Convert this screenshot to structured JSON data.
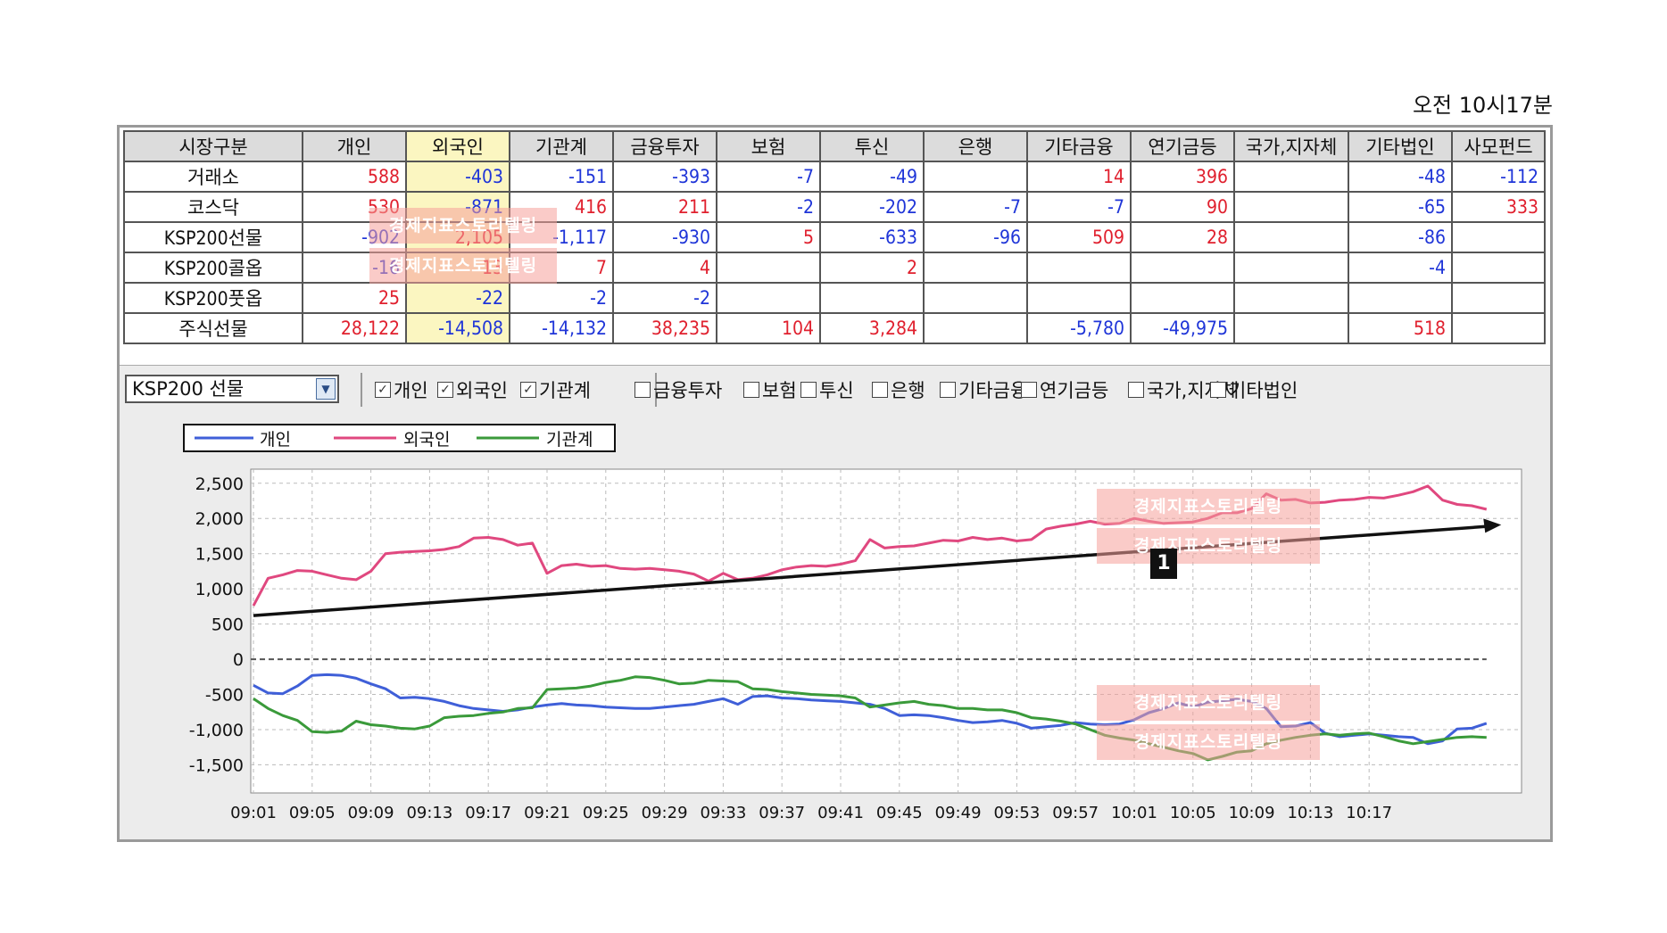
{
  "timestamp": "오전 10시17분",
  "table": {
    "headers": [
      "시장구분",
      "개인",
      "외국인",
      "기관계",
      "금융투자",
      "보험",
      "투신",
      "은행",
      "기타금융",
      "연기금등",
      "국가,지자체",
      "기타법인",
      "사모펀드"
    ],
    "rows": [
      {
        "label": "거래소",
        "values": [
          "588",
          "-403",
          "-151",
          "-393",
          "-7",
          "-49",
          "",
          "14",
          "396",
          "",
          "-48",
          "-112"
        ]
      },
      {
        "label": "코스닥",
        "values": [
          "530",
          "-871",
          "416",
          "211",
          "-2",
          "-202",
          "-7",
          "-7",
          "90",
          "",
          "-65",
          "333"
        ]
      },
      {
        "label": "KSP200선물",
        "values": [
          "-902",
          "2,105",
          "-1,117",
          "-930",
          "5",
          "-633",
          "-96",
          "509",
          "28",
          "",
          "-86",
          ""
        ]
      },
      {
        "label": "KSP200콜옵",
        "values": [
          "-16",
          "13",
          "7",
          "4",
          "",
          "2",
          "",
          "",
          "",
          "",
          "-4",
          ""
        ]
      },
      {
        "label": "KSP200풋옵",
        "values": [
          "25",
          "-22",
          "-2",
          "-2",
          "",
          "",
          "",
          "",
          "",
          "",
          "",
          ""
        ]
      },
      {
        "label": "주식선물",
        "values": [
          "28,122",
          "-14,508",
          "-14,132",
          "38,235",
          "104",
          "3,284",
          "",
          "-5,780",
          "-49,975",
          "",
          "518",
          ""
        ]
      }
    ]
  },
  "controls": {
    "select_value": "KSP200 선물",
    "checkboxes": [
      {
        "label": "개인",
        "checked": true
      },
      {
        "label": "외국인",
        "checked": true
      },
      {
        "label": "기관계",
        "checked": true
      },
      {
        "label": "금융투자",
        "checked": false
      },
      {
        "label": "보험",
        "checked": false
      },
      {
        "label": "투신",
        "checked": false
      },
      {
        "label": "은행",
        "checked": false
      },
      {
        "label": "기타금융",
        "checked": false
      },
      {
        "label": "연기금등",
        "checked": false
      },
      {
        "label": "국가,지자체",
        "checked": false
      },
      {
        "label": "기타법인",
        "checked": false
      }
    ]
  },
  "watermark_text": "경제지표스토리텔링",
  "annotation_badge": "1",
  "colors": {
    "individual": "#3f5fd8",
    "foreign": "#e0487f",
    "institution": "#3a9a3a",
    "positive": "#e0202e",
    "negative": "#1f35d8",
    "highlight": "#fbf6c1"
  },
  "chart_data": {
    "type": "line",
    "legend": [
      "개인",
      "외국인",
      "기관계"
    ],
    "legend_placement": "top-left",
    "x_tick_labels": [
      "09:01",
      "09:05",
      "09:09",
      "09:13",
      "09:17",
      "09:21",
      "09:25",
      "09:29",
      "09:33",
      "09:37",
      "09:41",
      "09:45",
      "09:49",
      "09:53",
      "09:57",
      "10:01",
      "10:05",
      "10:09",
      "10:13",
      "10:17"
    ],
    "ylim": [
      -1900,
      2700
    ],
    "y_ticks": [
      2500,
      2000,
      1500,
      1000,
      500,
      0,
      -500,
      -1000,
      -1500
    ],
    "y_tick_labels": [
      "2,500",
      "2,000",
      "1,500",
      "1,000",
      "500",
      "0",
      "-500",
      "-1,000",
      "-1,500"
    ],
    "grid": true,
    "zero_line": true,
    "x_minutes_range": [
      0,
      78
    ],
    "series": [
      {
        "name": "개인",
        "color": "#3f5fd8",
        "points": [
          [
            0,
            -370
          ],
          [
            1,
            -480
          ],
          [
            2,
            -490
          ],
          [
            3,
            -380
          ],
          [
            4,
            -230
          ],
          [
            5,
            -220
          ],
          [
            6,
            -230
          ],
          [
            7,
            -270
          ],
          [
            8,
            -350
          ],
          [
            9,
            -420
          ],
          [
            10,
            -550
          ],
          [
            11,
            -540
          ],
          [
            12,
            -560
          ],
          [
            13,
            -600
          ],
          [
            14,
            -660
          ],
          [
            15,
            -700
          ],
          [
            16,
            -720
          ],
          [
            17,
            -740
          ],
          [
            18,
            -720
          ],
          [
            19,
            -680
          ],
          [
            20,
            -650
          ],
          [
            21,
            -630
          ],
          [
            22,
            -650
          ],
          [
            23,
            -660
          ],
          [
            24,
            -680
          ],
          [
            25,
            -690
          ],
          [
            26,
            -700
          ],
          [
            27,
            -700
          ],
          [
            28,
            -680
          ],
          [
            29,
            -660
          ],
          [
            30,
            -640
          ],
          [
            31,
            -600
          ],
          [
            32,
            -560
          ],
          [
            33,
            -640
          ],
          [
            34,
            -530
          ],
          [
            35,
            -520
          ],
          [
            36,
            -550
          ],
          [
            37,
            -560
          ],
          [
            38,
            -580
          ],
          [
            39,
            -590
          ],
          [
            40,
            -600
          ],
          [
            41,
            -620
          ],
          [
            42,
            -640
          ],
          [
            43,
            -700
          ],
          [
            44,
            -800
          ],
          [
            45,
            -790
          ],
          [
            46,
            -800
          ],
          [
            47,
            -830
          ],
          [
            48,
            -870
          ],
          [
            49,
            -900
          ],
          [
            50,
            -890
          ],
          [
            51,
            -870
          ],
          [
            52,
            -910
          ],
          [
            53,
            -980
          ],
          [
            54,
            -960
          ],
          [
            55,
            -940
          ],
          [
            56,
            -900
          ],
          [
            57,
            -920
          ],
          [
            58,
            -930
          ],
          [
            59,
            -920
          ],
          [
            60,
            -860
          ],
          [
            61,
            -760
          ],
          [
            62,
            -700
          ],
          [
            63,
            -620
          ],
          [
            64,
            -680
          ],
          [
            65,
            -610
          ],
          [
            66,
            -590
          ],
          [
            67,
            -570
          ],
          [
            68,
            -600
          ],
          [
            69,
            -700
          ],
          [
            70,
            -960
          ],
          [
            71,
            -950
          ],
          [
            72,
            -900
          ],
          [
            73,
            -1050
          ],
          [
            74,
            -1100
          ],
          [
            75,
            -1080
          ],
          [
            76,
            -1060
          ],
          [
            77,
            -1080
          ],
          [
            78,
            -1100
          ],
          [
            79,
            -1110
          ],
          [
            80,
            -1200
          ],
          [
            81,
            -1160
          ],
          [
            82,
            -990
          ],
          [
            83,
            -980
          ],
          [
            84,
            -910
          ]
        ]
      },
      {
        "name": "외국인",
        "color": "#e0487f",
        "points": [
          [
            0,
            760
          ],
          [
            1,
            1150
          ],
          [
            2,
            1200
          ],
          [
            3,
            1260
          ],
          [
            4,
            1250
          ],
          [
            5,
            1200
          ],
          [
            6,
            1150
          ],
          [
            7,
            1130
          ],
          [
            8,
            1250
          ],
          [
            9,
            1500
          ],
          [
            10,
            1520
          ],
          [
            11,
            1530
          ],
          [
            12,
            1540
          ],
          [
            13,
            1560
          ],
          [
            14,
            1600
          ],
          [
            15,
            1720
          ],
          [
            16,
            1730
          ],
          [
            17,
            1700
          ],
          [
            18,
            1620
          ],
          [
            19,
            1650
          ],
          [
            20,
            1220
          ],
          [
            21,
            1330
          ],
          [
            22,
            1350
          ],
          [
            23,
            1320
          ],
          [
            24,
            1330
          ],
          [
            25,
            1290
          ],
          [
            26,
            1280
          ],
          [
            27,
            1290
          ],
          [
            28,
            1270
          ],
          [
            29,
            1250
          ],
          [
            30,
            1210
          ],
          [
            31,
            1110
          ],
          [
            32,
            1220
          ],
          [
            33,
            1130
          ],
          [
            34,
            1150
          ],
          [
            35,
            1200
          ],
          [
            36,
            1270
          ],
          [
            37,
            1310
          ],
          [
            38,
            1330
          ],
          [
            39,
            1320
          ],
          [
            40,
            1350
          ],
          [
            41,
            1400
          ],
          [
            42,
            1700
          ],
          [
            43,
            1580
          ],
          [
            44,
            1600
          ],
          [
            45,
            1610
          ],
          [
            46,
            1650
          ],
          [
            47,
            1690
          ],
          [
            48,
            1680
          ],
          [
            49,
            1730
          ],
          [
            50,
            1700
          ],
          [
            51,
            1720
          ],
          [
            52,
            1680
          ],
          [
            53,
            1700
          ],
          [
            54,
            1850
          ],
          [
            55,
            1890
          ],
          [
            56,
            1920
          ],
          [
            57,
            1960
          ],
          [
            58,
            1920
          ],
          [
            59,
            1930
          ],
          [
            60,
            2000
          ],
          [
            61,
            1960
          ],
          [
            62,
            1930
          ],
          [
            63,
            1940
          ],
          [
            64,
            1950
          ],
          [
            65,
            2000
          ],
          [
            66,
            2080
          ],
          [
            67,
            2080
          ],
          [
            68,
            2140
          ],
          [
            69,
            2350
          ],
          [
            70,
            2260
          ],
          [
            71,
            2270
          ],
          [
            72,
            2220
          ],
          [
            73,
            2230
          ],
          [
            74,
            2260
          ],
          [
            75,
            2270
          ],
          [
            76,
            2300
          ],
          [
            77,
            2290
          ],
          [
            78,
            2330
          ],
          [
            79,
            2380
          ],
          [
            80,
            2460
          ],
          [
            81,
            2260
          ],
          [
            82,
            2200
          ],
          [
            83,
            2180
          ],
          [
            84,
            2130
          ]
        ]
      },
      {
        "name": "기관계",
        "color": "#3a9a3a",
        "points": [
          [
            0,
            -560
          ],
          [
            1,
            -700
          ],
          [
            2,
            -800
          ],
          [
            3,
            -870
          ],
          [
            4,
            -1030
          ],
          [
            5,
            -1040
          ],
          [
            6,
            -1020
          ],
          [
            7,
            -880
          ],
          [
            8,
            -930
          ],
          [
            9,
            -950
          ],
          [
            10,
            -980
          ],
          [
            11,
            -990
          ],
          [
            12,
            -950
          ],
          [
            13,
            -830
          ],
          [
            14,
            -810
          ],
          [
            15,
            -800
          ],
          [
            16,
            -770
          ],
          [
            17,
            -750
          ],
          [
            18,
            -700
          ],
          [
            19,
            -690
          ],
          [
            20,
            -430
          ],
          [
            21,
            -420
          ],
          [
            22,
            -410
          ],
          [
            23,
            -380
          ],
          [
            24,
            -330
          ],
          [
            25,
            -300
          ],
          [
            26,
            -250
          ],
          [
            27,
            -260
          ],
          [
            28,
            -300
          ],
          [
            29,
            -350
          ],
          [
            30,
            -340
          ],
          [
            31,
            -300
          ],
          [
            32,
            -310
          ],
          [
            33,
            -320
          ],
          [
            34,
            -420
          ],
          [
            35,
            -430
          ],
          [
            36,
            -460
          ],
          [
            37,
            -480
          ],
          [
            38,
            -500
          ],
          [
            39,
            -510
          ],
          [
            40,
            -520
          ],
          [
            41,
            -550
          ],
          [
            42,
            -680
          ],
          [
            43,
            -650
          ],
          [
            44,
            -620
          ],
          [
            45,
            -600
          ],
          [
            46,
            -640
          ],
          [
            47,
            -660
          ],
          [
            48,
            -700
          ],
          [
            49,
            -700
          ],
          [
            50,
            -720
          ],
          [
            51,
            -720
          ],
          [
            52,
            -760
          ],
          [
            53,
            -830
          ],
          [
            54,
            -850
          ],
          [
            55,
            -880
          ],
          [
            56,
            -920
          ],
          [
            57,
            -1000
          ],
          [
            58,
            -1080
          ],
          [
            59,
            -1120
          ],
          [
            60,
            -1150
          ],
          [
            61,
            -1200
          ],
          [
            62,
            -1250
          ],
          [
            63,
            -1300
          ],
          [
            64,
            -1340
          ],
          [
            65,
            -1430
          ],
          [
            66,
            -1380
          ],
          [
            67,
            -1320
          ],
          [
            68,
            -1300
          ],
          [
            69,
            -1200
          ],
          [
            70,
            -1150
          ],
          [
            71,
            -1110
          ],
          [
            72,
            -1080
          ],
          [
            73,
            -1060
          ],
          [
            74,
            -1080
          ],
          [
            75,
            -1060
          ],
          [
            76,
            -1050
          ],
          [
            77,
            -1100
          ],
          [
            78,
            -1160
          ],
          [
            79,
            -1200
          ],
          [
            80,
            -1170
          ],
          [
            81,
            -1140
          ],
          [
            82,
            -1110
          ],
          [
            83,
            -1100
          ],
          [
            84,
            -1110
          ]
        ]
      }
    ],
    "trend_arrow": {
      "from": [
        0,
        620
      ],
      "to": [
        85,
        1910
      ]
    }
  }
}
